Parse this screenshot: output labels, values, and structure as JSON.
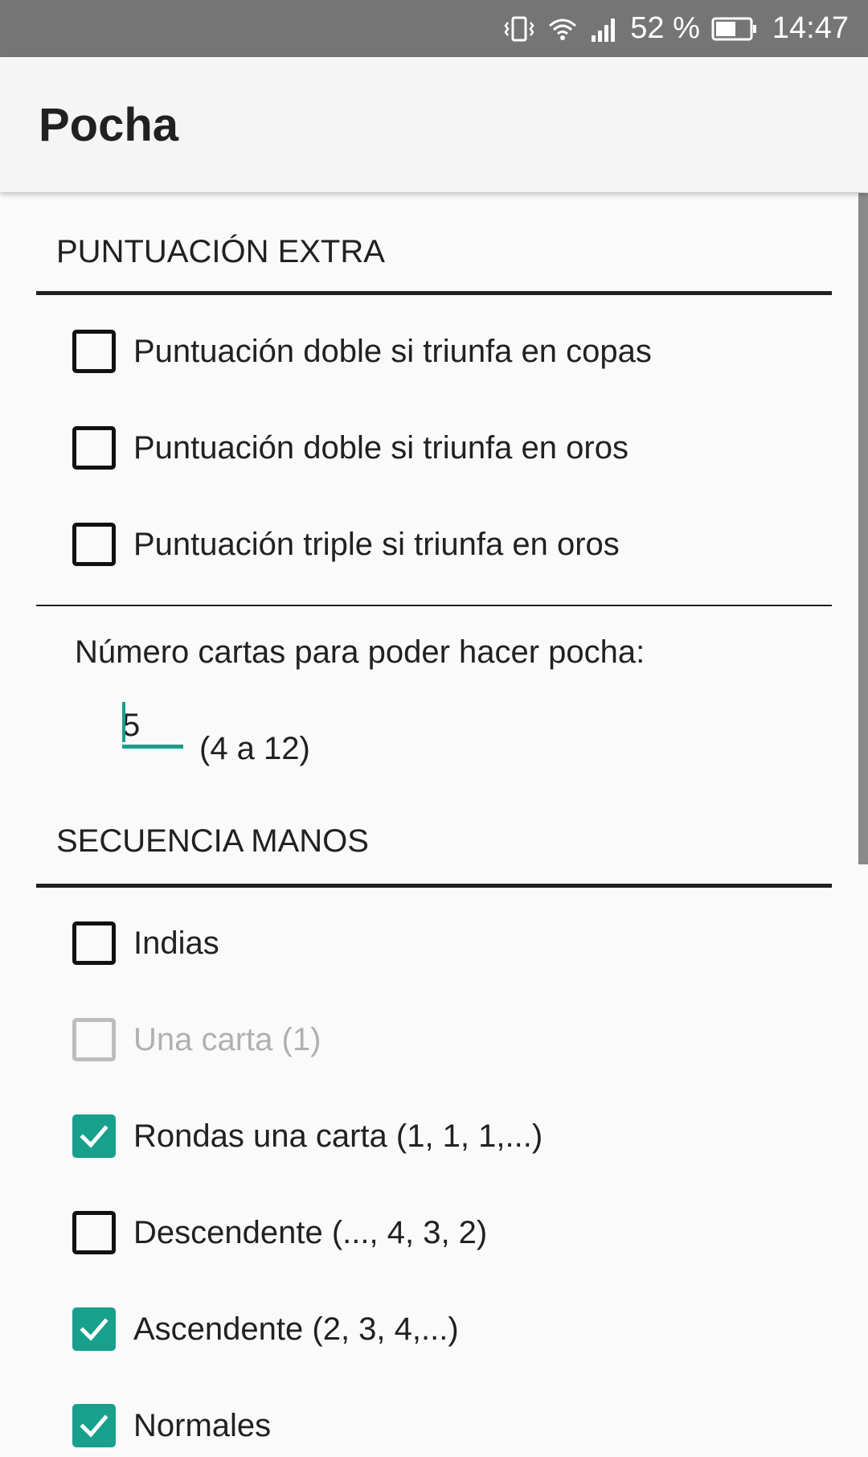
{
  "status_bar": {
    "battery_percent": "52 %",
    "time": "14:47"
  },
  "app_bar": {
    "title": "Pocha"
  },
  "puntuacion_extra": {
    "header": "PUNTUACIÓN EXTRA",
    "options": [
      {
        "label": "Puntuación doble si triunfa en copas",
        "checked": false,
        "enabled": true
      },
      {
        "label": "Puntuación doble si triunfa en oros",
        "checked": false,
        "enabled": true
      },
      {
        "label": "Puntuación triple si triunfa en oros",
        "checked": false,
        "enabled": true
      }
    ],
    "pocha_cards_label": "Número cartas para poder hacer pocha:",
    "pocha_cards_value": "5",
    "pocha_cards_range": "(4 a 12)"
  },
  "secuencia_manos": {
    "header": "SECUENCIA MANOS",
    "options": [
      {
        "label": "Indias",
        "checked": false,
        "enabled": true
      },
      {
        "label": "Una carta (1)",
        "checked": false,
        "enabled": false
      },
      {
        "label": "Rondas una carta (1, 1, 1,...)",
        "checked": true,
        "enabled": true
      },
      {
        "label": "Descendente (..., 4, 3, 2)",
        "checked": false,
        "enabled": true
      },
      {
        "label": "Ascendente (2, 3, 4,...)",
        "checked": true,
        "enabled": true
      },
      {
        "label": "Normales",
        "checked": true,
        "enabled": true
      }
    ]
  },
  "colors": {
    "accent": "#17a08d",
    "status_bar": "#757575",
    "app_bar": "#f5f5f5"
  }
}
